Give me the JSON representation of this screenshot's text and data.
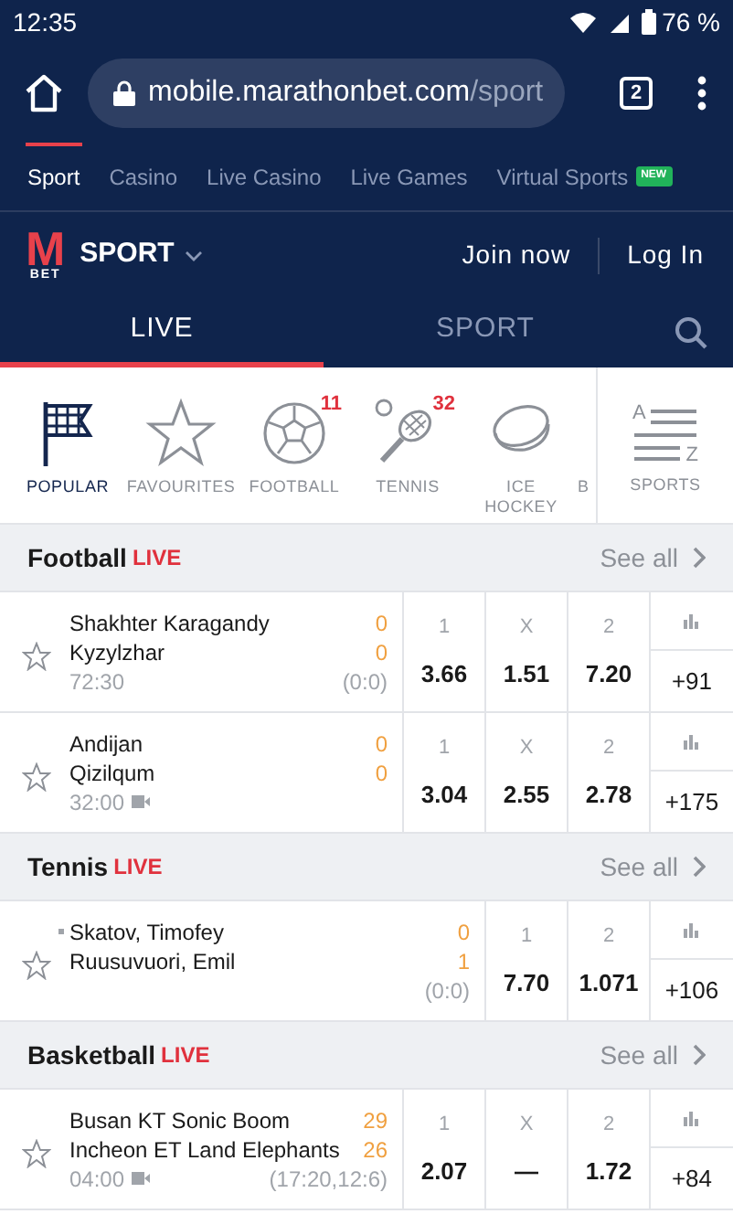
{
  "status_bar": {
    "time": "12:35",
    "battery": "76 %"
  },
  "browser": {
    "url_host": "mobile.marathonbet.com",
    "url_path": "/sport",
    "tab_count": "2"
  },
  "site_nav": [
    {
      "label": "Sport",
      "selected": true
    },
    {
      "label": "Casino",
      "selected": false
    },
    {
      "label": "Live Casino",
      "selected": false
    },
    {
      "label": "Live Games",
      "selected": false
    },
    {
      "label": "Virtual Sports",
      "selected": false,
      "badge": "NEW"
    }
  ],
  "header": {
    "logo_top": "M",
    "logo_bottom": "BET",
    "section": "SPORT",
    "join": "Join now",
    "login": "Log In"
  },
  "mode_tabs": [
    {
      "label": "LIVE",
      "selected": true
    },
    {
      "label": "SPORT",
      "selected": false
    }
  ],
  "sports_nav": [
    {
      "kind": "flag",
      "label": "POPULAR",
      "selected": true
    },
    {
      "kind": "star",
      "label": "FAVOURITES",
      "selected": false
    },
    {
      "kind": "ball",
      "label": "FOOTBALL",
      "count": "11",
      "selected": false
    },
    {
      "kind": "racket",
      "label": "TENNIS",
      "count": "32",
      "selected": false
    },
    {
      "kind": "puck",
      "label": "ICE HOCKEY",
      "selected": false
    },
    {
      "kind": "none",
      "label": "B",
      "selected": false
    }
  ],
  "sports_menu": {
    "label": "SPORTS",
    "letter_top": "A",
    "letter_bottom": "Z"
  },
  "sections": [
    {
      "title": "Football",
      "live": "LIVE",
      "see_all": "See all",
      "matches": [
        {
          "teams": [
            {
              "name": "Shakhter Karagandy",
              "score": "0",
              "serving": false
            },
            {
              "name": "Kyzylzhar",
              "score": "0",
              "serving": false
            }
          ],
          "time": "72:30",
          "video": false,
          "period": "(0:0)",
          "odds": [
            {
              "label": "1",
              "value": "3.66"
            },
            {
              "label": "X",
              "value": "1.51"
            },
            {
              "label": "2",
              "value": "7.20"
            }
          ],
          "more": "+91"
        },
        {
          "teams": [
            {
              "name": "Andijan",
              "score": "0",
              "serving": false
            },
            {
              "name": "Qizilqum",
              "score": "0",
              "serving": false
            }
          ],
          "time": "32:00",
          "video": true,
          "odds": [
            {
              "label": "1",
              "value": "3.04"
            },
            {
              "label": "X",
              "value": "2.55"
            },
            {
              "label": "2",
              "value": "2.78"
            }
          ],
          "more": "+175"
        }
      ]
    },
    {
      "title": "Tennis",
      "live": "LIVE",
      "see_all": "See all",
      "matches": [
        {
          "teams": [
            {
              "name": "Skatov, Timofey",
              "score": "0",
              "serving": true
            },
            {
              "name": "Ruusuvuori, Emil",
              "score": "1",
              "serving": false
            }
          ],
          "video": false,
          "period": "(0:0)",
          "odds": [
            {
              "label": "1",
              "value": "7.70"
            },
            {
              "label": "2",
              "value": "1.071"
            }
          ],
          "more": "+106"
        }
      ]
    },
    {
      "title": "Basketball",
      "live": "LIVE",
      "see_all": "See all",
      "matches": [
        {
          "teams": [
            {
              "name": "Busan KT Sonic Boom",
              "score": "29",
              "serving": false
            },
            {
              "name": "Incheon ET Land Elephants",
              "score": "26",
              "serving": false
            }
          ],
          "time": "04:00",
          "video": true,
          "period": "(17:20,12:6)",
          "odds": [
            {
              "label": "1",
              "value": "2.07"
            },
            {
              "label": "X",
              "value": "—"
            },
            {
              "label": "2",
              "value": "1.72"
            }
          ],
          "more": "+84"
        }
      ]
    }
  ]
}
